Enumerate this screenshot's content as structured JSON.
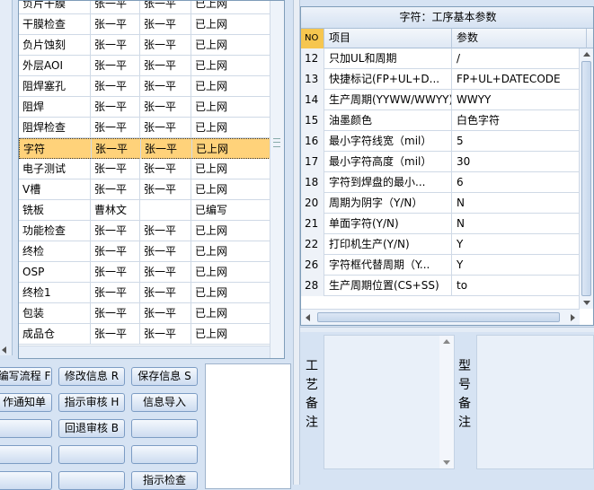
{
  "process_list": {
    "rows": [
      {
        "name": "负片干膜",
        "maker": "张一平",
        "checker": "张一平",
        "status": "已上网"
      },
      {
        "name": "干膜检查",
        "maker": "张一平",
        "checker": "张一平",
        "status": "已上网"
      },
      {
        "name": "负片蚀刻",
        "maker": "张一平",
        "checker": "张一平",
        "status": "已上网"
      },
      {
        "name": "外层AOI",
        "maker": "张一平",
        "checker": "张一平",
        "status": "已上网"
      },
      {
        "name": "阻焊塞孔",
        "maker": "张一平",
        "checker": "张一平",
        "status": "已上网"
      },
      {
        "name": "阻焊",
        "maker": "张一平",
        "checker": "张一平",
        "status": "已上网"
      },
      {
        "name": "阻焊检查",
        "maker": "张一平",
        "checker": "张一平",
        "status": "已上网"
      },
      {
        "name": "字符",
        "maker": "张一平",
        "checker": "张一平",
        "status": "已上网"
      },
      {
        "name": "电子测试",
        "maker": "张一平",
        "checker": "张一平",
        "status": "已上网"
      },
      {
        "name": "V槽",
        "maker": "张一平",
        "checker": "张一平",
        "status": "已上网"
      },
      {
        "name": "铣板",
        "maker": "曹林文",
        "checker": "",
        "status": "已编写"
      },
      {
        "name": "功能检查",
        "maker": "张一平",
        "checker": "张一平",
        "status": "已上网"
      },
      {
        "name": "终检",
        "maker": "张一平",
        "checker": "张一平",
        "status": "已上网"
      },
      {
        "name": "OSP",
        "maker": "张一平",
        "checker": "张一平",
        "status": "已上网"
      },
      {
        "name": "终检1",
        "maker": "张一平",
        "checker": "张一平",
        "status": "已上网"
      },
      {
        "name": "包装",
        "maker": "张一平",
        "checker": "张一平",
        "status": "已上网"
      },
      {
        "name": "成品仓",
        "maker": "张一平",
        "checker": "张一平",
        "status": "已上网"
      }
    ],
    "selected": "字符"
  },
  "buttons": {
    "write_flow": "编写流程 F",
    "modify_info": "修改信息 R",
    "save_info": "保存信息 S",
    "work_notice": "作通知单",
    "instruct_review": "指示审核 H",
    "import_info": "信息导入",
    "return_review": "回退审核 B",
    "instruct_check": "指示检查"
  },
  "param_table": {
    "title": "字符：工序基本参数",
    "headers": {
      "no": "NO",
      "item": "项目",
      "value": "参数"
    },
    "rows": [
      {
        "no": "12",
        "item": "只加UL和周期",
        "value": "/"
      },
      {
        "no": "13",
        "item": "快捷标记(FP+UL+D...",
        "value": "FP+UL+DATECODE"
      },
      {
        "no": "14",
        "item": "生产周期(YYWW/WWYY)",
        "value": "WWYY"
      },
      {
        "no": "15",
        "item": "油墨颜色",
        "value": "白色字符"
      },
      {
        "no": "16",
        "item": "最小字符线宽（mil）",
        "value": "5"
      },
      {
        "no": "17",
        "item": "最小字符高度（mil）",
        "value": "30"
      },
      {
        "no": "18",
        "item": "字符到焊盘的最小...",
        "value": "6"
      },
      {
        "no": "20",
        "item": "周期为阴字（Y/N）",
        "value": "N"
      },
      {
        "no": "21",
        "item": "单面字符(Y/N)",
        "value": "N"
      },
      {
        "no": "22",
        "item": "打印机生产(Y/N)",
        "value": "Y"
      },
      {
        "no": "26",
        "item": "字符框代替周期（Y...",
        "value": "Y"
      },
      {
        "no": "28",
        "item": "生产周期位置(CS+SS)",
        "value": "to"
      }
    ]
  },
  "remarks": {
    "process_label": "工艺备注",
    "model_label": "型号备注",
    "process_text": "",
    "model_text": ""
  },
  "colors": {
    "selected_row": "#ffd27a",
    "header_no": "#f6c64f",
    "background": "#d6e3f3"
  }
}
